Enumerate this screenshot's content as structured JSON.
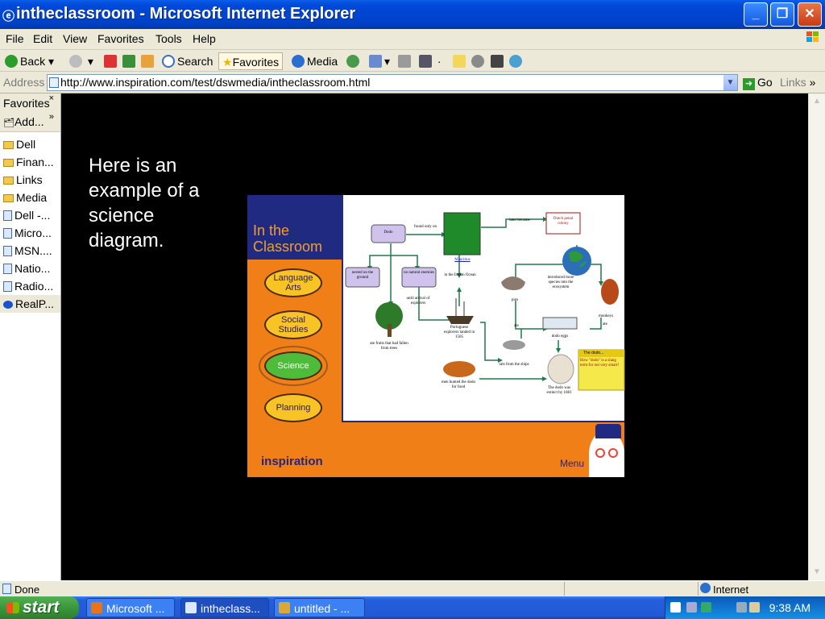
{
  "window": {
    "title": "intheclassroom - Microsoft Internet Explorer",
    "buttons": {
      "minimize": "_",
      "restore": "❐",
      "close": "✕"
    }
  },
  "menubar": {
    "items": [
      "File",
      "Edit",
      "View",
      "Favorites",
      "Tools",
      "Help"
    ]
  },
  "toolbar": {
    "back": "Back",
    "search": "Search",
    "favorites": "Favorites",
    "media": "Media"
  },
  "address": {
    "label": "Address",
    "url": "http://www.inspiration.com/test/dswmedia/intheclassroom.html",
    "go": "Go",
    "links": "Links",
    "links_chevron": "»"
  },
  "favorites_panel": {
    "title": "Favorites",
    "close": "×",
    "add": "Add...",
    "add_chevron": "»",
    "items": [
      {
        "label": "Dell",
        "type": "folder"
      },
      {
        "label": "Finan...",
        "type": "folder"
      },
      {
        "label": "Links",
        "type": "folder"
      },
      {
        "label": "Media",
        "type": "folder"
      },
      {
        "label": "Dell -...",
        "type": "page"
      },
      {
        "label": "Micro...",
        "type": "page"
      },
      {
        "label": "MSN....",
        "type": "page"
      },
      {
        "label": "Natio...",
        "type": "page"
      },
      {
        "label": "Radio...",
        "type": "page"
      },
      {
        "label": "RealP...",
        "type": "realplayer"
      }
    ]
  },
  "content": {
    "caption": "Here is an example of a science diagram.",
    "slide": {
      "title": "In the Classroom",
      "menu_items": [
        "Language Arts",
        "Social Studies",
        "Science",
        "Planning"
      ],
      "selected": "Science",
      "brand": "inspiration",
      "menu_label": "Menu",
      "diagram": {
        "nodes": [
          "Dodo",
          "found only on",
          "Mauritius",
          "later became",
          "Dutch penal colony",
          "nested on the ground",
          "no natural enemies",
          "in the Indian Ocean",
          "introduced more species into the ecosystem",
          "until arrival of explorers",
          "Portuguese explorers landed in 1505",
          "ate fruits that had fallen from trees",
          "pigs",
          "monkeys",
          "ate",
          "dodo eggs",
          "rats from the ships",
          "men hunted the dodo for food",
          "The dodo was extinct by 1681",
          "The dodo...",
          "How \"dodo\" is a slang term for not very smart!"
        ]
      }
    }
  },
  "statusbar": {
    "text": "Done",
    "zone": "Internet"
  },
  "taskbar": {
    "start": "start",
    "tasks": [
      "Microsoft ...",
      "intheclass...",
      "untitled - ..."
    ],
    "clock": "9:38 AM"
  }
}
